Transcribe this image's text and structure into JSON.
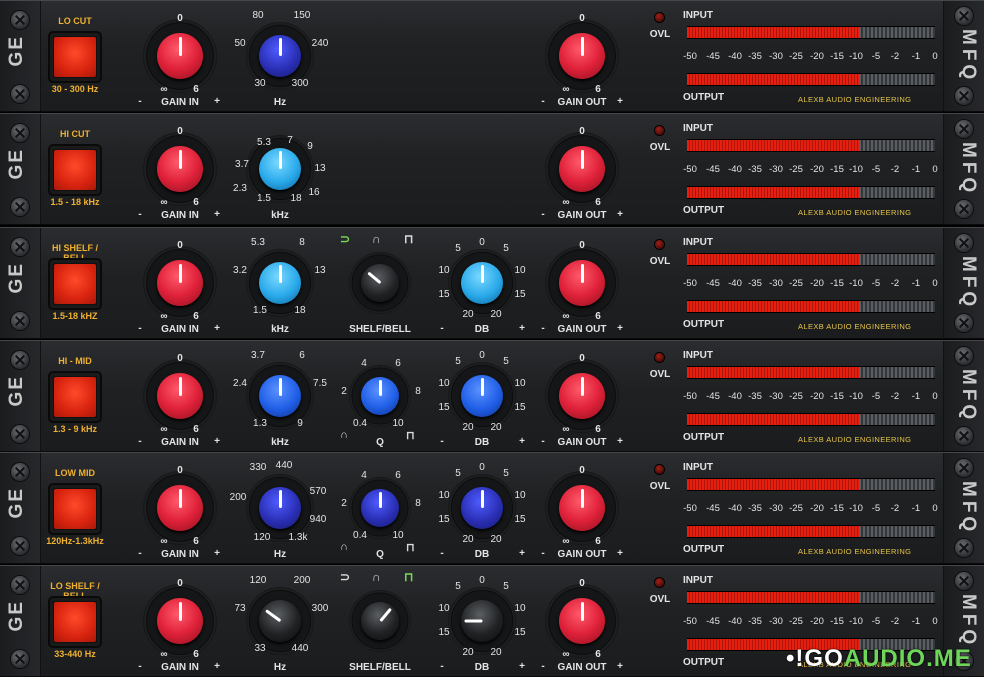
{
  "rack_labels": {
    "left": "GE",
    "right": "MFQ"
  },
  "common": {
    "gain_in": "GAIN IN",
    "gain_out": "GAIN OUT",
    "minus": "-",
    "plus": "+",
    "inf": "∞",
    "zero": "0",
    "six": "6",
    "ovl": "OVL",
    "input": "INPUT",
    "output": "OUTPUT",
    "brand": "ALEXB AUDIO ENGINEERING",
    "meter_scale": [
      "-50",
      "-45",
      "-40",
      "-35",
      "-30",
      "-25",
      "-20",
      "-15",
      "-10",
      "-5",
      "-2",
      "-1",
      "0"
    ]
  },
  "colors": {
    "red_knob": "#e0223a",
    "accent_orange": "#f0b130",
    "led_red": "#e52010"
  },
  "bands": [
    {
      "title": "LO CUT",
      "range": "30 - 300 Hz",
      "freq_color": "dark-blue",
      "freq_unit": "Hz",
      "freq_ticks": [
        "80",
        "150",
        "50",
        "240",
        "30",
        "300"
      ],
      "freq_value_fraction": 0.5
    },
    {
      "title": "HI CUT",
      "range": "1.5 - 18 kHz",
      "freq_color": "light-blue",
      "freq_unit": "kHz",
      "freq_ticks": [
        "5.3",
        "7",
        "3.7",
        "9",
        "13",
        "2.3",
        "16",
        "1.5",
        "18"
      ],
      "freq_value_fraction": 0.5
    },
    {
      "title": "HI SHELF / BELL",
      "range": "1.5-18 kHZ",
      "freq_color": "light-blue",
      "freq_unit": "kHz",
      "freq_ticks": [
        "5.3",
        "8",
        "3.2",
        "13",
        "1.5",
        "18"
      ],
      "freq_value_fraction": 0.5,
      "shape_label": "SHELF/BELL",
      "db_label": "DB",
      "db_ticks": [
        "0",
        "5",
        "5",
        "10",
        "10",
        "15",
        "15",
        "20",
        "20"
      ]
    },
    {
      "title": "HI - MID",
      "range": "1.3 - 9 kHz",
      "freq_color": "blue",
      "freq_unit": "kHz",
      "freq_ticks": [
        "3.7",
        "6",
        "2.4",
        "7.5",
        "1.3",
        "9"
      ],
      "freq_value_fraction": 0.5,
      "q_label": "Q",
      "q_ticks": [
        "4",
        "6",
        "2",
        "8",
        "0.4",
        "10"
      ],
      "db_label": "DB",
      "db_ticks": [
        "0",
        "5",
        "5",
        "10",
        "10",
        "15",
        "15",
        "20",
        "20"
      ]
    },
    {
      "title": "LOW MID",
      "range": "120Hz-1.3kHz",
      "freq_color": "dark-blue",
      "freq_unit": "Hz",
      "freq_ticks": [
        "330",
        "440",
        "200",
        "570",
        "940",
        "120",
        "1.3k"
      ],
      "freq_value_fraction": 0.5,
      "q_label": "Q",
      "q_ticks": [
        "4",
        "6",
        "2",
        "8",
        "0.4",
        "10"
      ],
      "db_label": "DB",
      "db_ticks": [
        "0",
        "5",
        "5",
        "10",
        "10",
        "15",
        "15",
        "20",
        "20"
      ]
    },
    {
      "title": "LO SHELF / BELL",
      "range": "33-440 Hz",
      "freq_color": "black",
      "freq_unit": "Hz",
      "freq_ticks": [
        "120",
        "200",
        "73",
        "300",
        "33",
        "440"
      ],
      "freq_value_fraction": 0.3,
      "shape_label": "SHELF/BELL",
      "db_label": "DB",
      "db_ticks": [
        "0",
        "5",
        "5",
        "10",
        "10",
        "15",
        "15",
        "20",
        "20"
      ]
    }
  ],
  "watermark": {
    "prefix": "•!GO",
    "suffix": "AUDIO.ME"
  }
}
